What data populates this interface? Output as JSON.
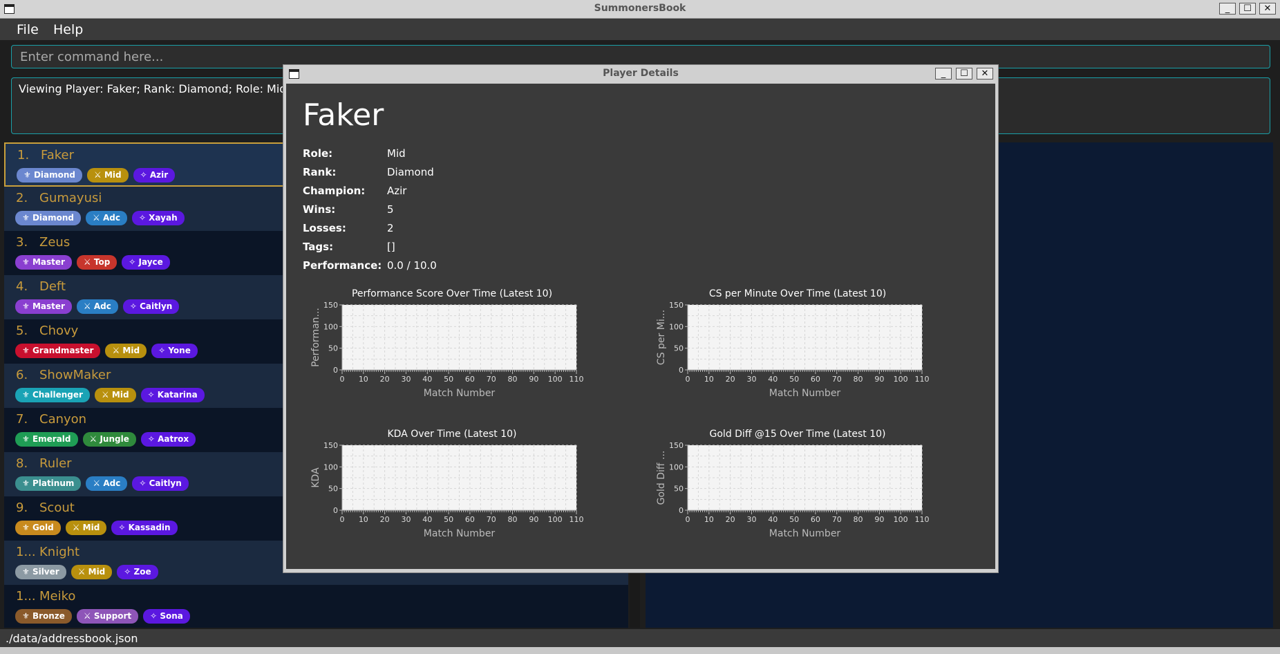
{
  "app": {
    "title": "SummonersBook"
  },
  "menu": {
    "file": "File",
    "help": "Help"
  },
  "command": {
    "placeholder": "Enter command here..."
  },
  "result": {
    "text": "Viewing Player: Faker; Rank: Diamond; Role: Mid; Ch"
  },
  "players": [
    {
      "index": "1.",
      "name": "Faker",
      "rank": "Diamond",
      "role": "Mid",
      "champion": "Azir"
    },
    {
      "index": "2.",
      "name": "Gumayusi",
      "rank": "Diamond",
      "role": "Adc",
      "champion": "Xayah"
    },
    {
      "index": "3.",
      "name": "Zeus",
      "rank": "Master",
      "role": "Top",
      "champion": "Jayce"
    },
    {
      "index": "4.",
      "name": "Deft",
      "rank": "Master",
      "role": "Adc",
      "champion": "Caitlyn"
    },
    {
      "index": "5.",
      "name": "Chovy",
      "rank": "Grandmaster",
      "role": "Mid",
      "champion": "Yone"
    },
    {
      "index": "6.",
      "name": "ShowMaker",
      "rank": "Challenger",
      "role": "Mid",
      "champion": "Katarina"
    },
    {
      "index": "7.",
      "name": "Canyon",
      "rank": "Emerald",
      "role": "Jungle",
      "champion": "Aatrox"
    },
    {
      "index": "8.",
      "name": "Ruler",
      "rank": "Platinum",
      "role": "Adc",
      "champion": "Caitlyn"
    },
    {
      "index": "9.",
      "name": "Scout",
      "rank": "Gold",
      "role": "Mid",
      "champion": "Kassadin"
    },
    {
      "index": "1...",
      "name": "Knight",
      "rank": "Silver",
      "role": "Mid",
      "champion": "Zoe"
    },
    {
      "index": "1...",
      "name": "Meiko",
      "rank": "Bronze",
      "role": "Support",
      "champion": "Sona"
    }
  ],
  "colors": {
    "rank": {
      "Diamond": "#6b87cf",
      "Master": "#8a3fd0",
      "Grandmaster": "#c8102e",
      "Challenger": "#1aa3b5",
      "Emerald": "#1f9d55",
      "Platinum": "#3b8f8f",
      "Gold": "#c88a1e",
      "Silver": "#8c9aa3",
      "Bronze": "#8a5a2b"
    },
    "role": {
      "Mid": "#b8900e",
      "Adc": "#2a7ec4",
      "Top": "#c7352c",
      "Jungle": "#2f8a3c",
      "Support": "#8e55b8"
    },
    "champion": "#5b18e0",
    "selected_border": "#c9a03b",
    "accent": "#1aa0a8"
  },
  "icons": {
    "rank": "fleur-de-lis-icon",
    "role": "crossed-swords-icon",
    "champion": "sparkle-icon"
  },
  "status_bar": {
    "path": "./data/addressbook.json"
  },
  "dialog": {
    "title": "Player Details",
    "player_name": "Faker",
    "fields": [
      {
        "label": "Role:",
        "value": "Mid"
      },
      {
        "label": "Rank:",
        "value": "Diamond"
      },
      {
        "label": "Champion:",
        "value": "Azir"
      },
      {
        "label": "Wins:",
        "value": "5"
      },
      {
        "label": "Losses:",
        "value": "2"
      },
      {
        "label": "Tags:",
        "value": "[]"
      },
      {
        "label": "Performance:",
        "value": "0.0 / 10.0"
      }
    ]
  },
  "chart_data": [
    {
      "type": "line",
      "title": "Performance Score Over Time (Latest 10)",
      "xlabel": "Match Number",
      "ylabel": "Performan...",
      "xlim": [
        0,
        110
      ],
      "ylim": [
        0,
        150
      ],
      "xticks": [
        0,
        10,
        20,
        30,
        40,
        50,
        60,
        70,
        80,
        90,
        100,
        110
      ],
      "yticks": [
        0,
        50,
        100,
        150
      ],
      "grid": true,
      "series": []
    },
    {
      "type": "line",
      "title": "CS per Minute Over Time (Latest 10)",
      "xlabel": "Match Number",
      "ylabel": "CS per Mi...",
      "xlim": [
        0,
        110
      ],
      "ylim": [
        0,
        150
      ],
      "xticks": [
        0,
        10,
        20,
        30,
        40,
        50,
        60,
        70,
        80,
        90,
        100,
        110
      ],
      "yticks": [
        0,
        50,
        100,
        150
      ],
      "grid": true,
      "series": []
    },
    {
      "type": "line",
      "title": "KDA Over Time (Latest 10)",
      "xlabel": "Match Number",
      "ylabel": "KDA",
      "xlim": [
        0,
        110
      ],
      "ylim": [
        0,
        150
      ],
      "xticks": [
        0,
        10,
        20,
        30,
        40,
        50,
        60,
        70,
        80,
        90,
        100,
        110
      ],
      "yticks": [
        0,
        50,
        100,
        150
      ],
      "grid": true,
      "series": []
    },
    {
      "type": "line",
      "title": "Gold Diff @15 Over Time (Latest 10)",
      "xlabel": "Match Number",
      "ylabel": "Gold Diff ...",
      "xlim": [
        0,
        110
      ],
      "ylim": [
        0,
        150
      ],
      "xticks": [
        0,
        10,
        20,
        30,
        40,
        50,
        60,
        70,
        80,
        90,
        100,
        110
      ],
      "yticks": [
        0,
        50,
        100,
        150
      ],
      "grid": true,
      "series": []
    }
  ]
}
